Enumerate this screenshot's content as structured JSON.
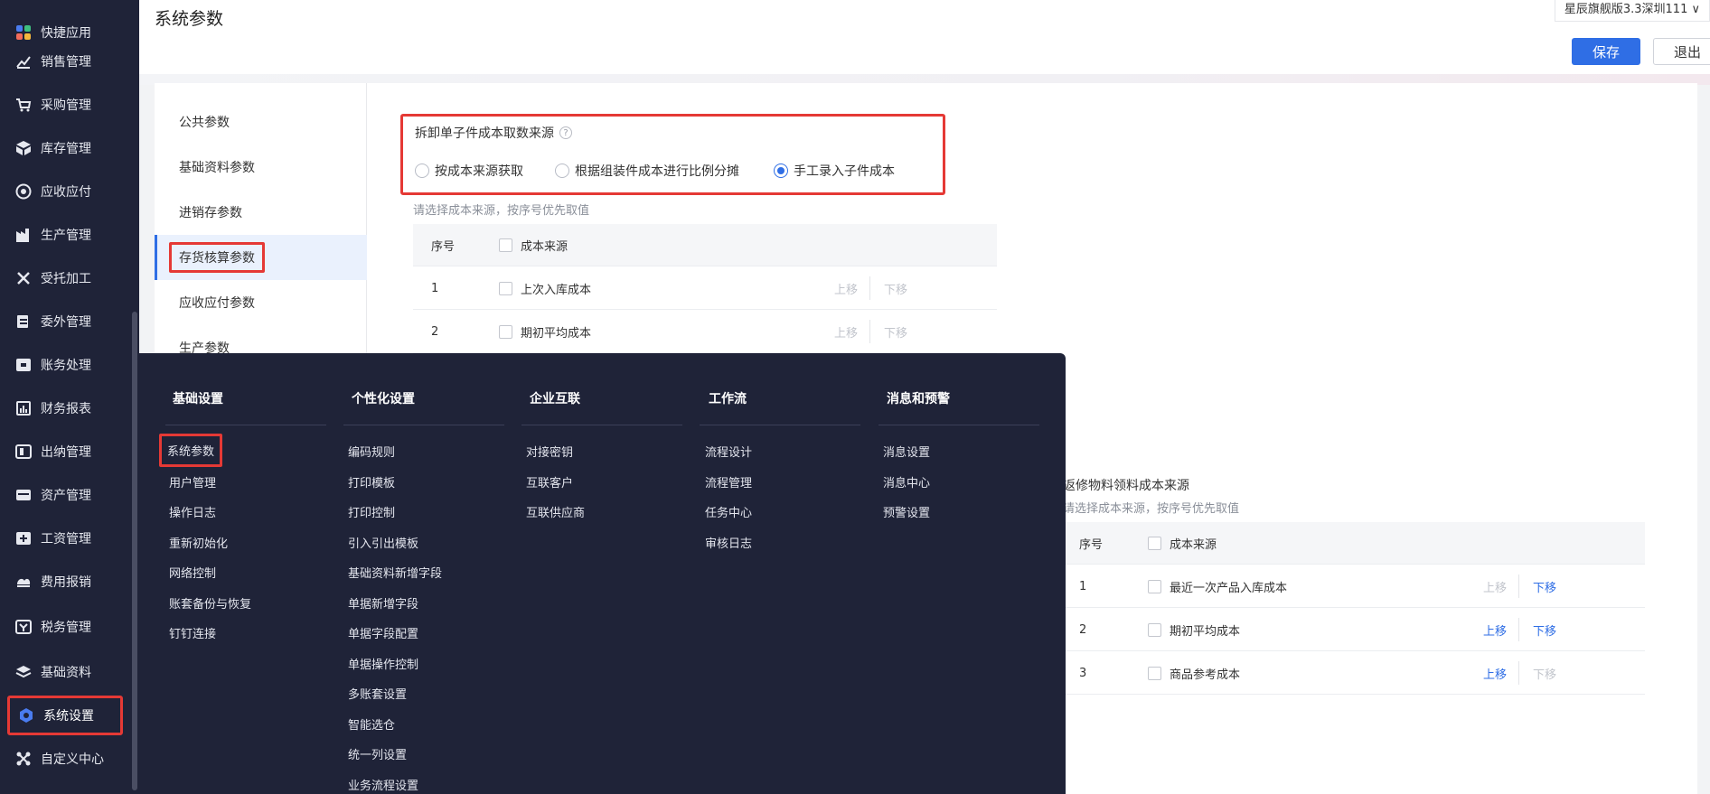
{
  "page": {
    "title": "系统参数",
    "account": "星辰旗舰版3.3深圳111 ∨",
    "save_label": "保存",
    "exit_label": "退出"
  },
  "sidebar": {
    "items": [
      {
        "label": "快捷应用",
        "icon": "grid-apps-icon"
      },
      {
        "label": "销售管理",
        "icon": "sales-chart-icon"
      },
      {
        "label": "采购管理",
        "icon": "shopping-cart-icon"
      },
      {
        "label": "库存管理",
        "icon": "inventory-box-icon"
      },
      {
        "label": "应收应付",
        "icon": "receivable-icon"
      },
      {
        "label": "生产管理",
        "icon": "factory-icon"
      },
      {
        "label": "受托加工",
        "icon": "tools-icon"
      },
      {
        "label": "委外管理",
        "icon": "outsourcing-icon"
      },
      {
        "label": "账务处理",
        "icon": "ledger-icon"
      },
      {
        "label": "财务报表",
        "icon": "report-icon"
      },
      {
        "label": "出纳管理",
        "icon": "cashier-icon"
      },
      {
        "label": "资产管理",
        "icon": "asset-icon"
      },
      {
        "label": "工资管理",
        "icon": "payroll-icon"
      },
      {
        "label": "费用报销",
        "icon": "expense-icon"
      },
      {
        "label": "税务管理",
        "icon": "tax-icon"
      },
      {
        "label": "基础资料",
        "icon": "layers-icon"
      },
      {
        "label": "系统设置",
        "icon": "settings-hex-icon"
      },
      {
        "label": "自定义中心",
        "icon": "custom-center-icon"
      }
    ],
    "active": "系统设置"
  },
  "left_menu": {
    "items": [
      "公共参数",
      "基础资料参数",
      "进销存参数",
      "存货核算参数",
      "应收应付参数",
      "生产参数"
    ],
    "active": "存货核算参数"
  },
  "radio_section": {
    "title": "拆卸单子件成本取数来源",
    "options": [
      "按成本来源获取",
      "根据组装件成本进行比例分摊",
      "手工录入子件成本"
    ],
    "selected": "手工录入子件成本"
  },
  "table1": {
    "hint": "请选择成本来源，按序号优先取值",
    "headers": {
      "seq": "序号",
      "source": "成本来源"
    },
    "rows": [
      {
        "seq": "1",
        "name": "上次入库成本",
        "up": "上移",
        "down": "下移",
        "up_enabled": false,
        "down_enabled": false
      },
      {
        "seq": "2",
        "name": "期初平均成本",
        "up": "上移",
        "down": "下移",
        "up_enabled": false,
        "down_enabled": false
      }
    ]
  },
  "table2": {
    "title": "返修物料领料成本来源",
    "hint": "请选择成本来源，按序号优先取值",
    "headers": {
      "seq": "序号",
      "source": "成本来源"
    },
    "rows": [
      {
        "seq": "1",
        "name": "最近一次产品入库成本",
        "up": "上移",
        "down": "下移",
        "up_enabled": false,
        "down_enabled": true
      },
      {
        "seq": "2",
        "name": "期初平均成本",
        "up": "上移",
        "down": "下移",
        "up_enabled": true,
        "down_enabled": true
      },
      {
        "seq": "3",
        "name": "商品参考成本",
        "up": "上移",
        "down": "下移",
        "up_enabled": true,
        "down_enabled": false
      }
    ]
  },
  "dropdown": {
    "columns": [
      {
        "title": "基础设置",
        "items": [
          "系统参数",
          "用户管理",
          "操作日志",
          "重新初始化",
          "网络控制",
          "账套备份与恢复",
          "钉钉连接"
        ]
      },
      {
        "title": "个性化设置",
        "items": [
          "编码规则",
          "打印模板",
          "打印控制",
          "引入引出模板",
          "基础资料新增字段",
          "单据新增字段",
          "单据字段配置",
          "单据操作控制",
          "多账套设置",
          "智能选仓",
          "统一列设置",
          "业务流程设置"
        ]
      },
      {
        "title": "企业互联",
        "items": [
          "对接密钥",
          "互联客户",
          "互联供应商"
        ]
      },
      {
        "title": "工作流",
        "items": [
          "流程设计",
          "流程管理",
          "任务中心",
          "审核日志"
        ]
      },
      {
        "title": "消息和预警",
        "items": [
          "消息设置",
          "消息中心",
          "预警设置"
        ]
      }
    ],
    "highlighted": "系统参数"
  }
}
